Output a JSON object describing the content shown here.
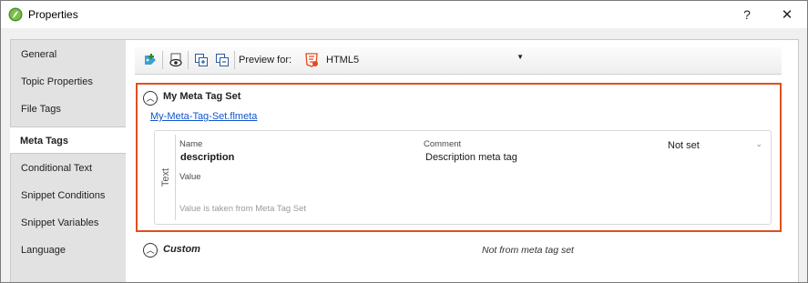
{
  "window": {
    "title": "Properties",
    "help_label": "?",
    "close_label": "✕",
    "colors": {
      "accent_border": "#e0501e",
      "link": "#1155cc",
      "app_icon": "#6aa84f"
    }
  },
  "nav": {
    "items": [
      {
        "label": "General"
      },
      {
        "label": "Topic Properties"
      },
      {
        "label": "File Tags"
      },
      {
        "label": "Meta Tags",
        "active": true
      },
      {
        "label": "Conditional Text"
      },
      {
        "label": "Snippet Conditions"
      },
      {
        "label": "Snippet Variables"
      },
      {
        "label": "Language"
      }
    ]
  },
  "toolbar": {
    "icons": [
      "add-tag-icon",
      "view-icon",
      "expand-all-icon",
      "collapse-all-icon"
    ],
    "preview_label": "Preview for:",
    "preview_value": "HTML5",
    "preview_icon": "html5-icon"
  },
  "meta_tag_set": {
    "title": "My Meta Tag Set",
    "file_link": "My-Meta-Tag-Set.flmeta",
    "tag": {
      "type_label": "Text",
      "name_label": "Name",
      "name_value": "description",
      "comment_label": "Comment",
      "comment_value": "Description meta tag",
      "status_value": "Not set",
      "value_label": "Value",
      "hint": "Value is taken from Meta Tag Set"
    }
  },
  "custom": {
    "title": "Custom",
    "note": "Not from meta tag set"
  }
}
